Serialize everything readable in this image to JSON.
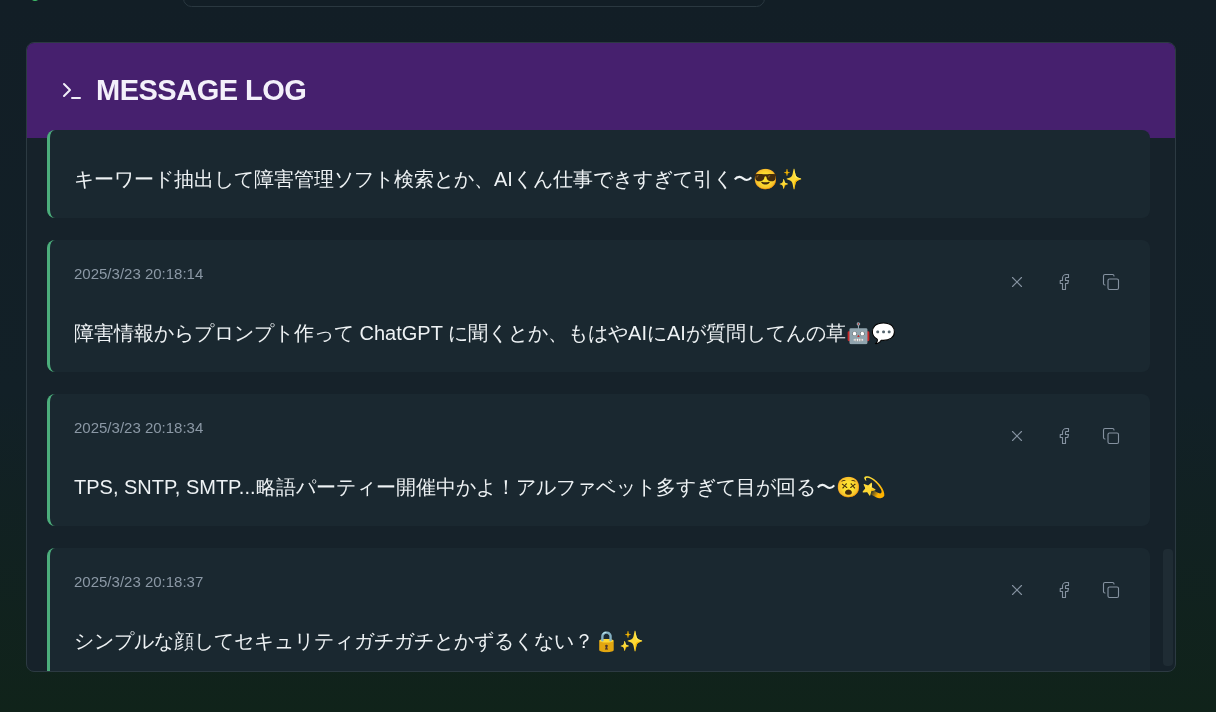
{
  "header": {
    "title": "MESSAGE LOG"
  },
  "messages": [
    {
      "text": "キーワード抽出して障害管理ソフト検索とか、AIくん仕事できすぎて引く〜😎✨"
    },
    {
      "timestamp": "2025/3/23 20:18:14",
      "text": "障害情報からプロンプト作って ChatGPT に聞くとか、もはやAIにAIが質問してんの草🤖💬"
    },
    {
      "timestamp": "2025/3/23 20:18:34",
      "text": "TPS, SNTP, SMTP...略語パーティー開催中かよ！アルファベット多すぎて目が回る〜😵💫"
    },
    {
      "timestamp": "2025/3/23 20:18:37",
      "text": "シンプルな顔してセキュリティガチガチとかずるくない？🔒✨"
    }
  ]
}
